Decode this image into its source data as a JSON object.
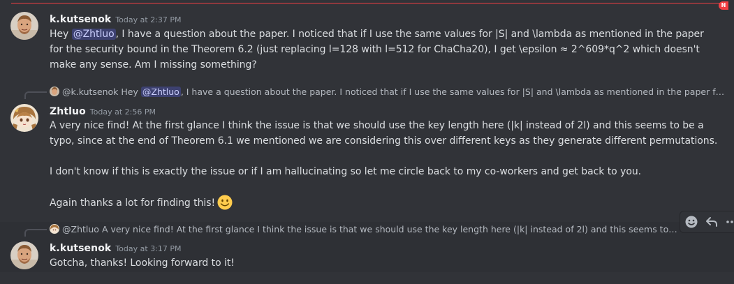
{
  "new_badge": "N",
  "messages": [
    {
      "author": "k.kutsenok",
      "timestamp": "Today at 2:37 PM",
      "avatar": "person-avatar",
      "text_before_mention": "Hey ",
      "mention": "@Zhtluo",
      "text_after_mention": ", I have a question about the paper. I noticed that if I use the same values for |S| and \\lambda as mentioned in the paper for the security bound in the Theorem 6.2 (just replacing l=128 with l=512 for ChaCha20), I get \\epsilon ≈ 2^609*q^2 which doesn't make any sense. Am I missing something?"
    },
    {
      "reply": {
        "author": "@k.kutsenok",
        "text_before_mention": "Hey ",
        "mention": "@Zhtluo",
        "text_after_mention": ", I have a question about the paper. I noticed that if I use the same values for |S| and \\lambda as mentioned in the paper for the sec..."
      },
      "author": "Zhtluo",
      "timestamp": "Today at 2:56 PM",
      "avatar": "anime-avatar",
      "paragraphs": [
        "A very nice find! At the first glance I think the issue is that we should use the key length here (|k| instead of 2l) and this seems to be a typo, since at the end of Theorem 6.1 we mentioned we are considering this over different keys as they generate different permutations.",
        "I don't know if this is exactly the issue or if I am hallucinating so let me circle back to my co-workers and get back to you.",
        "Again thanks a lot for finding this!"
      ],
      "emoji": "slightly-smiling-face-emoji"
    },
    {
      "reply": {
        "author": "@Zhtluo",
        "text": "A very nice find! At the first glance I think the issue is that we should use the key length here (|k| instead of 2l) and this seems to be a typo, si..."
      },
      "author": "k.kutsenok",
      "timestamp": "Today at 3:17 PM",
      "avatar": "person-avatar",
      "text": "Gotcha, thanks! Looking forward to it!"
    }
  ],
  "toolbar": {
    "icons": [
      "add-reaction-icon",
      "reply-icon",
      "more-icon"
    ]
  },
  "colors": {
    "background": "#313338",
    "hover_background": "#2e3035",
    "mention_bg": "#3c4270",
    "new_messages": "#f23f43"
  }
}
